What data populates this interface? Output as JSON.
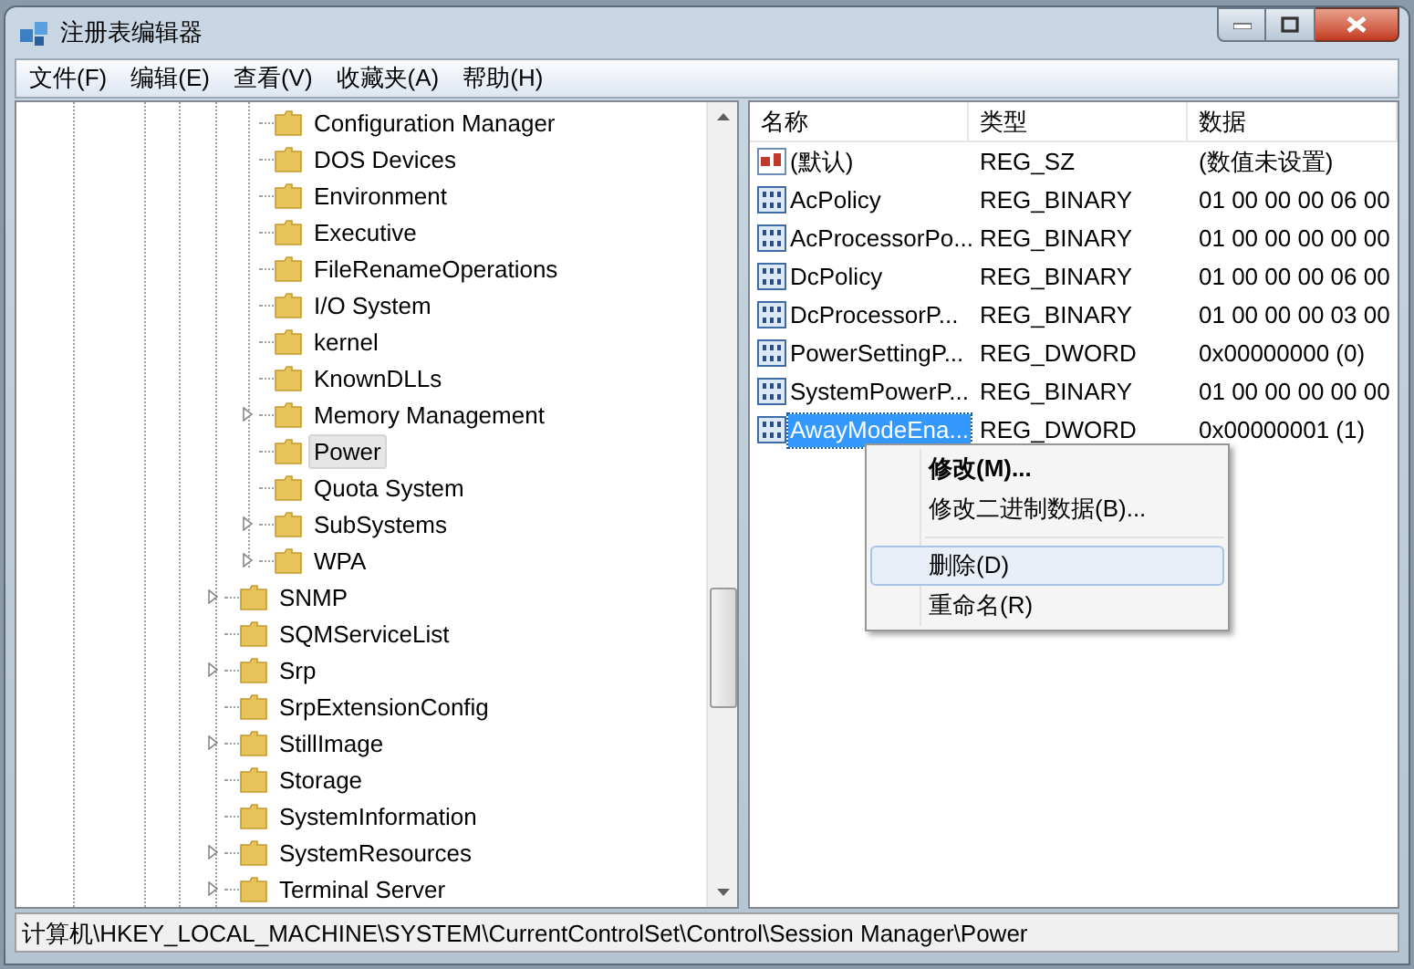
{
  "window": {
    "title": "注册表编辑器"
  },
  "menu": [
    "文件(F)",
    "编辑(E)",
    "查看(V)",
    "收藏夹(A)",
    "帮助(H)"
  ],
  "tree": {
    "inner_items": [
      {
        "label": "Configuration Manager",
        "expandable": false,
        "selected": false
      },
      {
        "label": "DOS Devices",
        "expandable": false,
        "selected": false
      },
      {
        "label": "Environment",
        "expandable": false,
        "selected": false
      },
      {
        "label": "Executive",
        "expandable": false,
        "selected": false
      },
      {
        "label": "FileRenameOperations",
        "expandable": false,
        "selected": false
      },
      {
        "label": "I/O System",
        "expandable": false,
        "selected": false
      },
      {
        "label": "kernel",
        "expandable": false,
        "selected": false
      },
      {
        "label": "KnownDLLs",
        "expandable": false,
        "selected": false
      },
      {
        "label": "Memory Management",
        "expandable": true,
        "selected": false
      },
      {
        "label": "Power",
        "expandable": false,
        "selected": true
      },
      {
        "label": "Quota System",
        "expandable": false,
        "selected": false
      },
      {
        "label": "SubSystems",
        "expandable": true,
        "selected": false
      },
      {
        "label": "WPA",
        "expandable": true,
        "selected": false
      }
    ],
    "outer_items": [
      {
        "label": "SNMP",
        "expandable": true,
        "selected": false
      },
      {
        "label": "SQMServiceList",
        "expandable": false,
        "selected": false
      },
      {
        "label": "Srp",
        "expandable": true,
        "selected": false
      },
      {
        "label": "SrpExtensionConfig",
        "expandable": false,
        "selected": false
      },
      {
        "label": "StillImage",
        "expandable": true,
        "selected": false
      },
      {
        "label": "Storage",
        "expandable": false,
        "selected": false
      },
      {
        "label": "SystemInformation",
        "expandable": false,
        "selected": false
      },
      {
        "label": "SystemResources",
        "expandable": true,
        "selected": false
      },
      {
        "label": "Terminal Server",
        "expandable": true,
        "selected": false
      }
    ]
  },
  "values": {
    "columns": [
      "名称",
      "类型",
      "数据"
    ],
    "rows": [
      {
        "kind": "string",
        "name": "(默认)",
        "type": "REG_SZ",
        "data": "(数值未设置)",
        "selected": false
      },
      {
        "kind": "binary",
        "name": "AcPolicy",
        "type": "REG_BINARY",
        "data": "01 00 00 00 06 00",
        "selected": false
      },
      {
        "kind": "binary",
        "name": "AcProcessorPo...",
        "type": "REG_BINARY",
        "data": "01 00 00 00 00 00",
        "selected": false
      },
      {
        "kind": "binary",
        "name": "DcPolicy",
        "type": "REG_BINARY",
        "data": "01 00 00 00 06 00",
        "selected": false
      },
      {
        "kind": "binary",
        "name": "DcProcessorP...",
        "type": "REG_BINARY",
        "data": "01 00 00 00 03 00",
        "selected": false
      },
      {
        "kind": "binary",
        "name": "PowerSettingP...",
        "type": "REG_DWORD",
        "data": "0x00000000 (0)",
        "selected": false
      },
      {
        "kind": "binary",
        "name": "SystemPowerP...",
        "type": "REG_BINARY",
        "data": "01 00 00 00 00 00",
        "selected": false
      },
      {
        "kind": "binary",
        "name": "AwayModeEna...",
        "type": "REG_DWORD",
        "data": "0x00000001 (1)",
        "selected": true
      }
    ]
  },
  "context_menu": [
    {
      "kind": "item",
      "label": "修改(M)...",
      "bold": true,
      "selected": false
    },
    {
      "kind": "item",
      "label": "修改二进制数据(B)...",
      "bold": false,
      "selected": false
    },
    {
      "kind": "separator"
    },
    {
      "kind": "item",
      "label": "删除(D)",
      "bold": false,
      "selected": true
    },
    {
      "kind": "item",
      "label": "重命名(R)",
      "bold": false,
      "selected": false
    }
  ],
  "status_bar": "计算机\\HKEY_LOCAL_MACHINE\\SYSTEM\\CurrentControlSet\\Control\\Session Manager\\Power"
}
